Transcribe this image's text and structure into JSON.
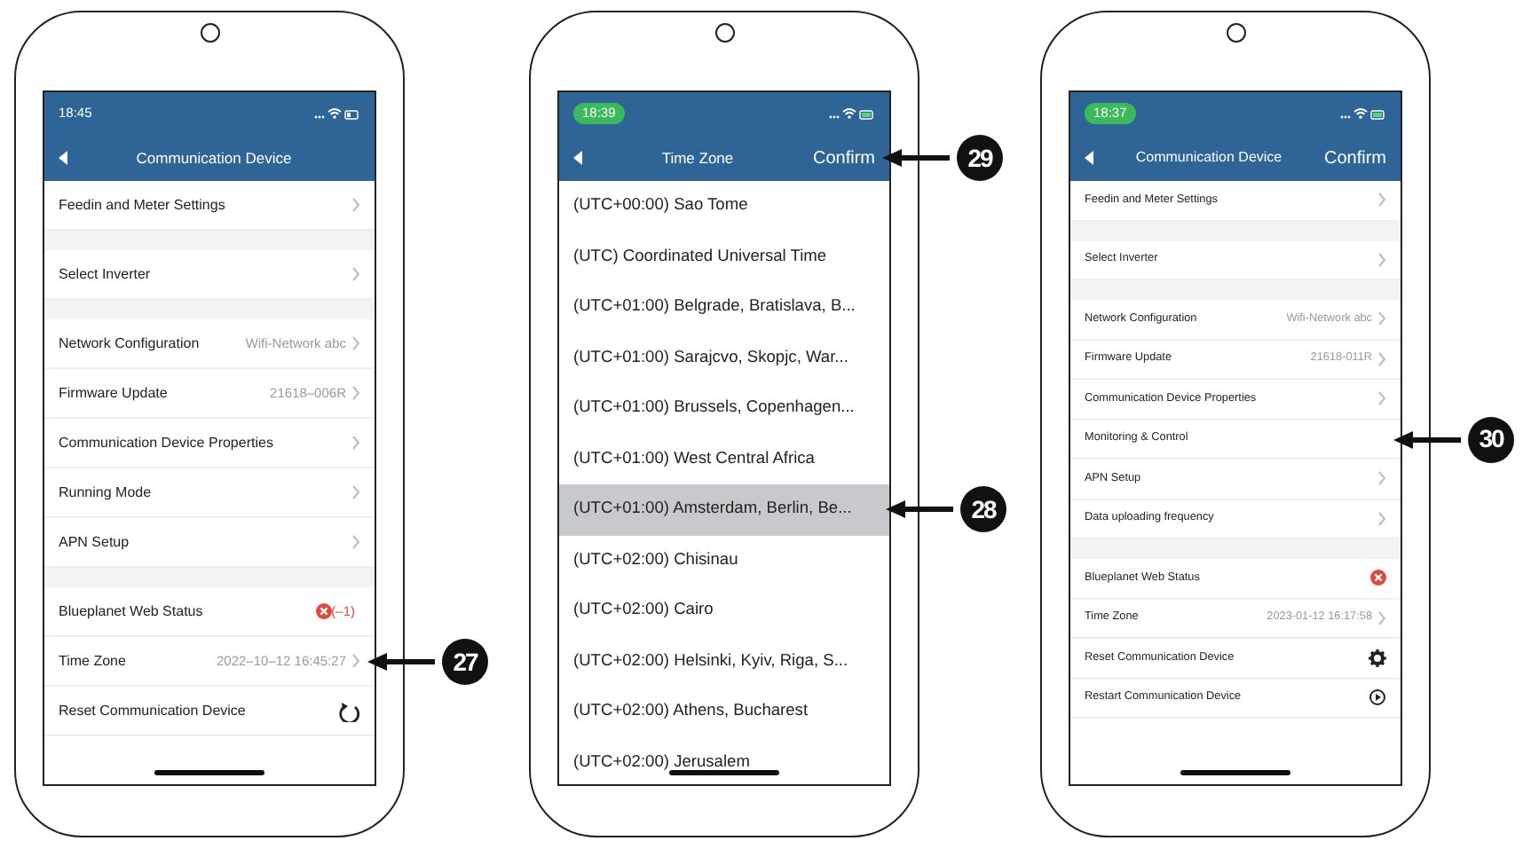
{
  "phones": [
    {
      "time": "18:45",
      "time_highlighted": false,
      "title": "Communication Device",
      "rows": [
        {
          "kind": "link",
          "label": "Feedin and Meter Settings"
        },
        {
          "kind": "spacer"
        },
        {
          "kind": "link",
          "label": "Select Inverter"
        },
        {
          "kind": "spacer"
        },
        {
          "kind": "link",
          "label": "Network Configuration",
          "value": "Wifi-Network abc"
        },
        {
          "kind": "link",
          "label": "Firmware Update",
          "value": "21618–006R"
        },
        {
          "kind": "link",
          "label": "Communication Device Properties"
        },
        {
          "kind": "link",
          "label": "Running Mode"
        },
        {
          "kind": "link",
          "label": "APN Setup"
        },
        {
          "kind": "spacer"
        },
        {
          "kind": "status",
          "label": "Blueplanet Web Status",
          "value": "(–1)"
        },
        {
          "kind": "link",
          "label": "Time Zone",
          "value": "2022–10–12 16:45:27",
          "callout": "27"
        },
        {
          "kind": "refresh",
          "label": "Reset Communication Device"
        }
      ]
    },
    {
      "time": "18:39",
      "time_highlighted": true,
      "title": "Time Zone",
      "confirm": "Confirm",
      "confirm_callout": "29",
      "zones": [
        {
          "label": "(UTC+00:00) Sao Tome",
          "selected": false
        },
        {
          "label": "(UTC) Coordinated Universal Time",
          "selected": false
        },
        {
          "label": "(UTC+01:00) Belgrade, Bratislava, B...",
          "selected": false
        },
        {
          "label": "(UTC+01:00) Sarajcvo, Skopjc, War...",
          "selected": false
        },
        {
          "label": "(UTC+01:00) Brussels, Copenhagen...",
          "selected": false
        },
        {
          "label": "(UTC+01:00) West Central Africa",
          "selected": false
        },
        {
          "label": "(UTC+01:00) Amsterdam, Berlin, Be...",
          "selected": true,
          "callout": "28"
        },
        {
          "label": "(UTC+02:00) Chisinau",
          "selected": false
        },
        {
          "label": "(UTC+02:00) Cairo",
          "selected": false
        },
        {
          "label": "(UTC+02:00) Helsinki, Kyiv, Riga, S...",
          "selected": false
        },
        {
          "label": "(UTC+02:00) Athens, Bucharest",
          "selected": false
        },
        {
          "label": "(UTC+02:00) Jerusalem",
          "selected": false
        }
      ]
    },
    {
      "time": "18:37",
      "time_highlighted": true,
      "title": "Communication Device",
      "confirm": "Confirm",
      "rows": [
        {
          "kind": "link",
          "label": "Feedin and Meter Settings"
        },
        {
          "kind": "spacer"
        },
        {
          "kind": "link",
          "label": "Select Inverter"
        },
        {
          "kind": "spacer"
        },
        {
          "kind": "link",
          "label": "Network Configuration",
          "value": "Wifi-Network abc"
        },
        {
          "kind": "link",
          "label": "Firmware Update",
          "value": "21618-011R"
        },
        {
          "kind": "link",
          "label": "Communication Device Properties"
        },
        {
          "kind": "plain",
          "label": "Monitoring & Control",
          "callout": "30"
        },
        {
          "kind": "link",
          "label": "APN Setup"
        },
        {
          "kind": "link",
          "label": "Data uploading frequency"
        },
        {
          "kind": "spacer"
        },
        {
          "kind": "status",
          "label": "Blueplanet Web Status"
        },
        {
          "kind": "link",
          "label": "Time Zone",
          "value": "2023-01-12 16:17:58"
        },
        {
          "kind": "gear",
          "label": "Reset Communication Device"
        },
        {
          "kind": "restart",
          "label": "Restart Communication Device"
        }
      ]
    }
  ]
}
